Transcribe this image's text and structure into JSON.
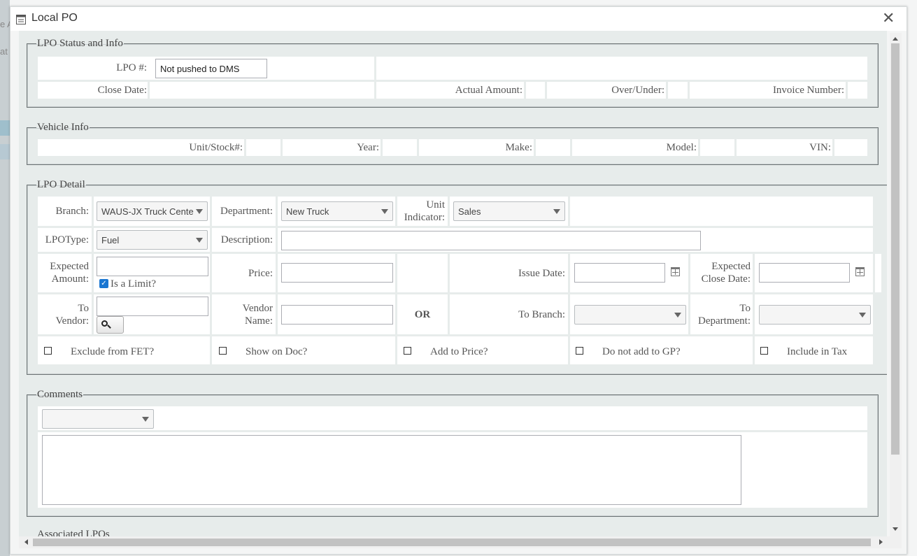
{
  "background": {
    "fragment_1": "e A",
    "fragment_2": "at"
  },
  "dialog": {
    "title": "Local PO",
    "close_label": "✕",
    "status_section": {
      "legend": "LPO Status and Info",
      "lpo_label": "LPO #:",
      "lpo_value": "Not pushed to DMS",
      "close_date_label": "Close Date:",
      "actual_amount_label": "Actual Amount:",
      "over_under_label": "Over/Under:",
      "invoice_number_label": "Invoice Number:"
    },
    "vehicle_section": {
      "legend": "Vehicle Info",
      "unit_label": "Unit/Stock#:",
      "year_label": "Year:",
      "make_label": "Make:",
      "model_label": "Model:",
      "vin_label": "VIN:"
    },
    "detail_section": {
      "legend": "LPO Detail",
      "branch_label": "Branch:",
      "branch_value": "WAUS-JX Truck Cente",
      "department_label": "Department:",
      "department_value": "New Truck",
      "unit_indicator_label_1": "Unit",
      "unit_indicator_label_2": "Indicator:",
      "unit_indicator_value": "Sales",
      "lpo_type_label": "LPOType:",
      "lpo_type_value": "Fuel",
      "description_label": "Description:",
      "expected_amount_label_1": "Expected",
      "expected_amount_label_2": "Amount:",
      "is_limit_label": "Is a Limit?",
      "is_limit_checked": true,
      "price_label": "Price:",
      "issue_date_label": "Issue Date:",
      "expected_close_label_1": "Expected",
      "expected_close_label_2": "Close Date:",
      "to_vendor_label_1": "To",
      "to_vendor_label_2": "Vendor:",
      "vendor_name_label_1": "Vendor",
      "vendor_name_label_2": "Name:",
      "or_label": "OR",
      "to_branch_label": "To Branch:",
      "to_department_label_1": "To",
      "to_department_label_2": "Department:",
      "exclude_fet_label": "Exclude from FET?",
      "show_on_doc_label": "Show on Doc?",
      "add_to_price_label": "Add to Price?",
      "do_not_add_gp_label": "Do not add to GP?",
      "include_tax_label": "Include in Tax"
    },
    "comments_section": {
      "legend": "Comments"
    },
    "associated_section": {
      "legend": "Associated LPOs"
    }
  }
}
